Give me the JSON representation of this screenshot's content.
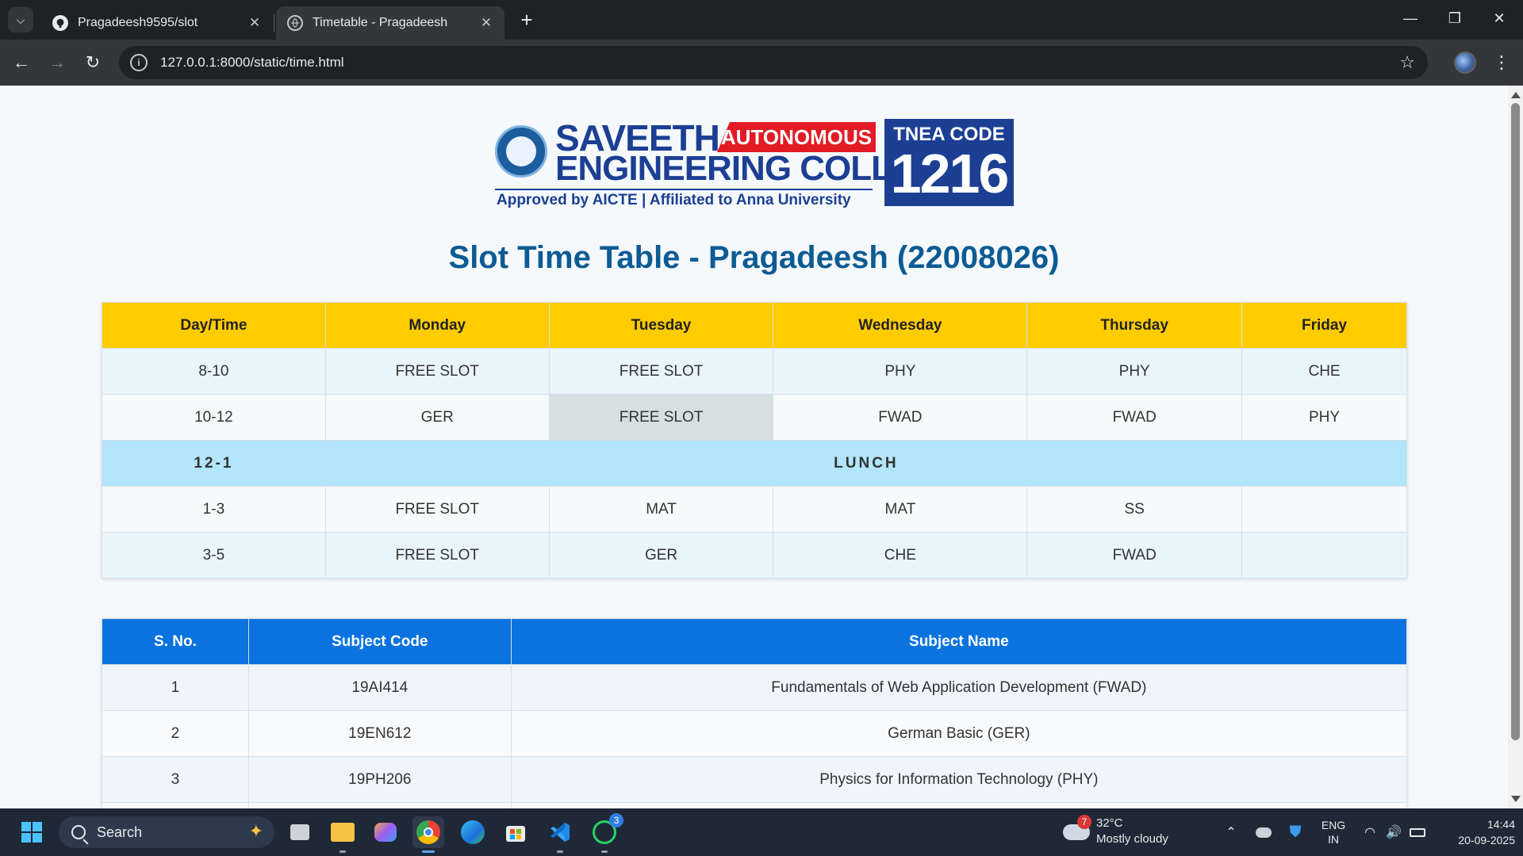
{
  "browser": {
    "tabs": [
      {
        "title": "Pragadeesh9595/slot",
        "icon": "github-icon",
        "active": false
      },
      {
        "title": "Timetable - Pragadeesh",
        "icon": "globe-icon",
        "active": true
      }
    ],
    "url": "127.0.0.1:8000/static/time.html"
  },
  "logo": {
    "line1": "SAVEETHA",
    "badge": "AUTONOMOUS",
    "line2": "ENGINEERING COLLEGE",
    "tagline": "Approved by AICTE | Affiliated to Anna University",
    "tnea_label": "TNEA CODE",
    "tnea_code": "1216"
  },
  "page": {
    "title": "Slot Time Table - Pragadeesh (22008026)"
  },
  "timetable": {
    "headers": [
      "Day/Time",
      "Monday",
      "Tuesday",
      "Wednesday",
      "Thursday",
      "Friday"
    ],
    "rows": [
      {
        "time": "8-10",
        "cells": [
          "FREE SLOT",
          "FREE SLOT",
          "PHY",
          "PHY",
          "CHE"
        ]
      },
      {
        "time": "10-12",
        "cells": [
          "GER",
          "FREE SLOT",
          "FWAD",
          "FWAD",
          "PHY"
        ]
      },
      {
        "time": "12-1",
        "lunch": "LUNCH"
      },
      {
        "time": "1-3",
        "cells": [
          "FREE SLOT",
          "MAT",
          "MAT",
          "SS",
          ""
        ]
      },
      {
        "time": "3-5",
        "cells": [
          "FREE SLOT",
          "GER",
          "CHE",
          "FWAD",
          ""
        ]
      }
    ]
  },
  "subjects": {
    "headers": [
      "S. No.",
      "Subject Code",
      "Subject Name"
    ],
    "rows": [
      {
        "sno": "1",
        "code": "19AI414",
        "name": "Fundamentals of Web Application Development (FWAD)"
      },
      {
        "sno": "2",
        "code": "19EN612",
        "name": "German Basic (GER)"
      },
      {
        "sno": "3",
        "code": "19PH206",
        "name": "Physics for Information Technology (PHY)"
      }
    ]
  },
  "taskbar": {
    "search_placeholder": "Search",
    "weather": {
      "temp": "32°C",
      "condition": "Mostly cloudy",
      "badge": "7"
    },
    "whatsapp_badge": "3",
    "language": "ENG",
    "region": "IN",
    "time": "14:44",
    "date": "20-09-2025"
  },
  "colors": {
    "timetable_header": "#ffcc00",
    "subject_header": "#0a73e0",
    "title": "#0c5b94",
    "lunch_row": "#b3e5fc"
  }
}
